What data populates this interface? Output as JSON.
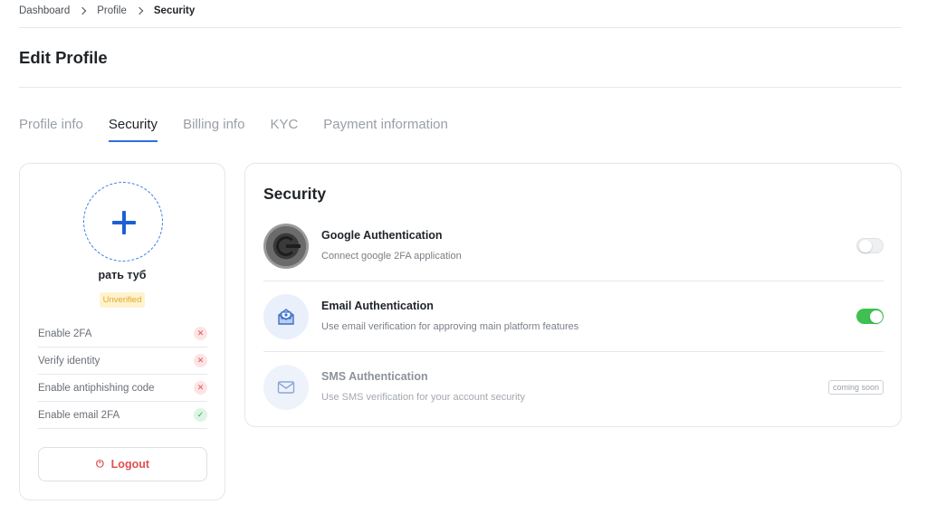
{
  "breadcrumb": {
    "items": [
      "Dashboard",
      "Profile"
    ],
    "current": "Security"
  },
  "page": {
    "title": "Edit Profile"
  },
  "tabs": [
    {
      "label": "Profile info",
      "active": false
    },
    {
      "label": "Security",
      "active": true
    },
    {
      "label": "Billing info",
      "active": false
    },
    {
      "label": "KYC",
      "active": false
    },
    {
      "label": "Payment information",
      "active": false
    }
  ],
  "profile": {
    "name": "рать туб",
    "status_badge": "Unverified",
    "checklist": [
      {
        "label": "Enable 2FA",
        "done": false
      },
      {
        "label": "Verify identity",
        "done": false
      },
      {
        "label": "Enable antiphishing code",
        "done": false
      },
      {
        "label": "Enable email 2FA",
        "done": true
      }
    ],
    "logout_label": "Logout"
  },
  "security": {
    "title": "Security",
    "methods": [
      {
        "title": "Google Authentication",
        "description": "Connect google 2FA application",
        "enabled": false,
        "icon": "google-authenticator-icon"
      },
      {
        "title": "Email Authentication",
        "description": "Use email verification for approving main platform features",
        "enabled": true,
        "icon": "email-icon"
      },
      {
        "title": "SMS Authentication",
        "description": "Use SMS verification for your account security",
        "badge": "coming soon",
        "icon": "envelope-icon"
      }
    ]
  },
  "colors": {
    "accent": "#2f6fe0",
    "toggle_on": "#3fc152",
    "danger": "#e05050",
    "warning_badge": "#e0a92a"
  }
}
